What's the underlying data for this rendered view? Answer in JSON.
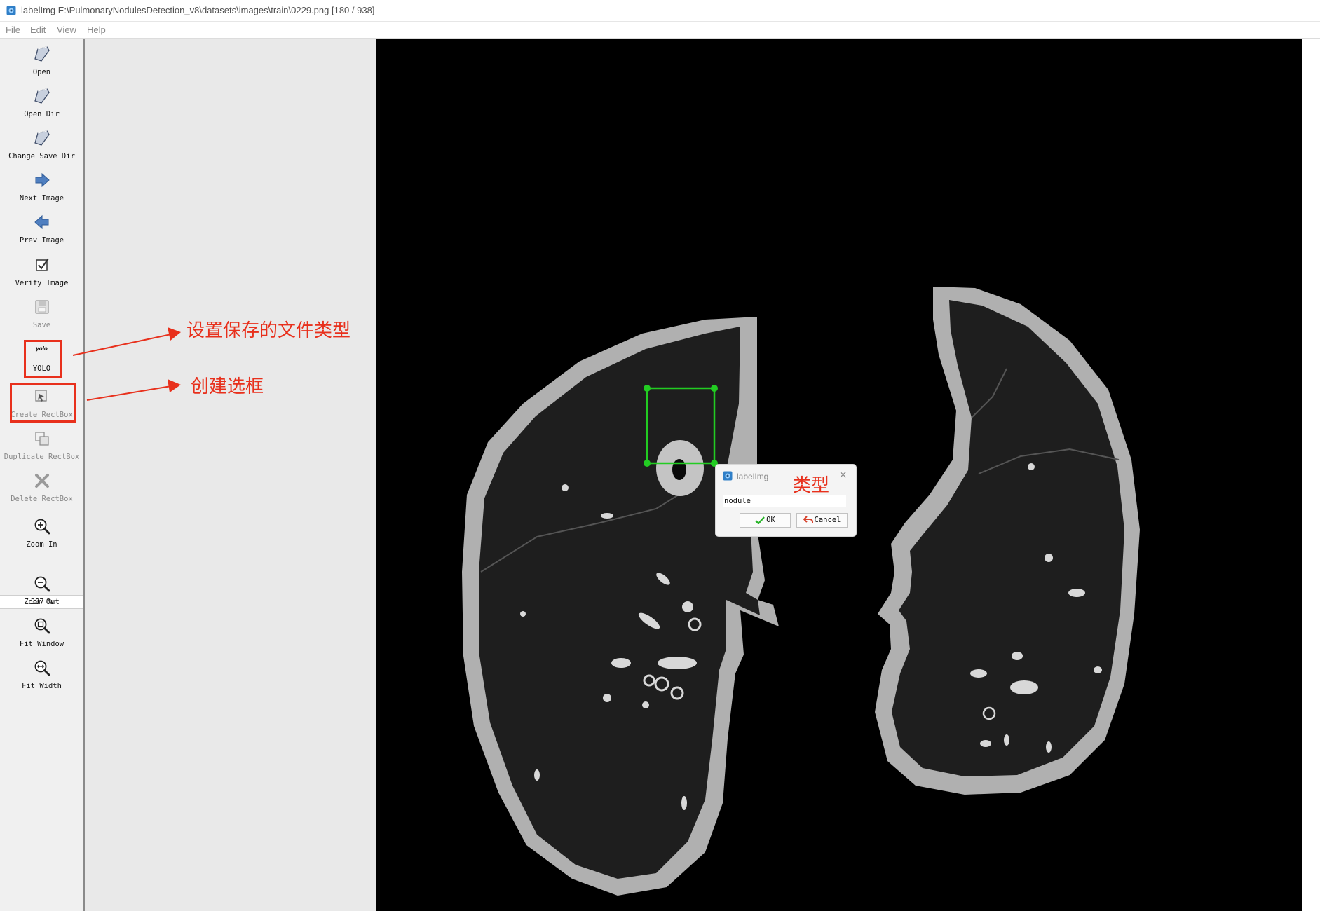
{
  "window": {
    "title": "labelImg E:\\PulmonaryNodulesDetection_v8\\datasets\\images\\train\\0229.png [180 / 938]"
  },
  "menu": [
    {
      "label": "File"
    },
    {
      "label": "Edit"
    },
    {
      "label": "View"
    },
    {
      "label": "Help"
    }
  ],
  "toolbar": {
    "open": "Open",
    "open_dir": "Open Dir",
    "change_save_dir": "Change Save Dir",
    "next_image": "Next Image",
    "prev_image": "Prev Image",
    "verify_image": "Verify Image",
    "save": "Save",
    "format_small": "yolo",
    "format": "YOLO",
    "create_rectbox": "Create RectBox",
    "duplicate_rectbox": "Duplicate RectBox",
    "delete_rectbox": "Delete RectBox",
    "zoom_in": "Zoom In",
    "zoom_value": "387 %",
    "zoom_out": "Zoom Out",
    "fit_window": "Fit Window",
    "fit_width": "Fit Width"
  },
  "annotations": {
    "save_format_note": "设置保存的文件类型",
    "create_box_note": "创建选框",
    "type_note": "类型"
  },
  "dialog": {
    "title": "labelImg",
    "close_glyph": "×",
    "label_value": "nodule",
    "ok_label": "OK",
    "cancel_label": "Cancel"
  },
  "colors": {
    "annotation_red": "#e8301c",
    "bbox_green": "#22cc22",
    "toolbar_bg": "#f0f0f0",
    "canvas_bg": "#e9e9e9"
  }
}
